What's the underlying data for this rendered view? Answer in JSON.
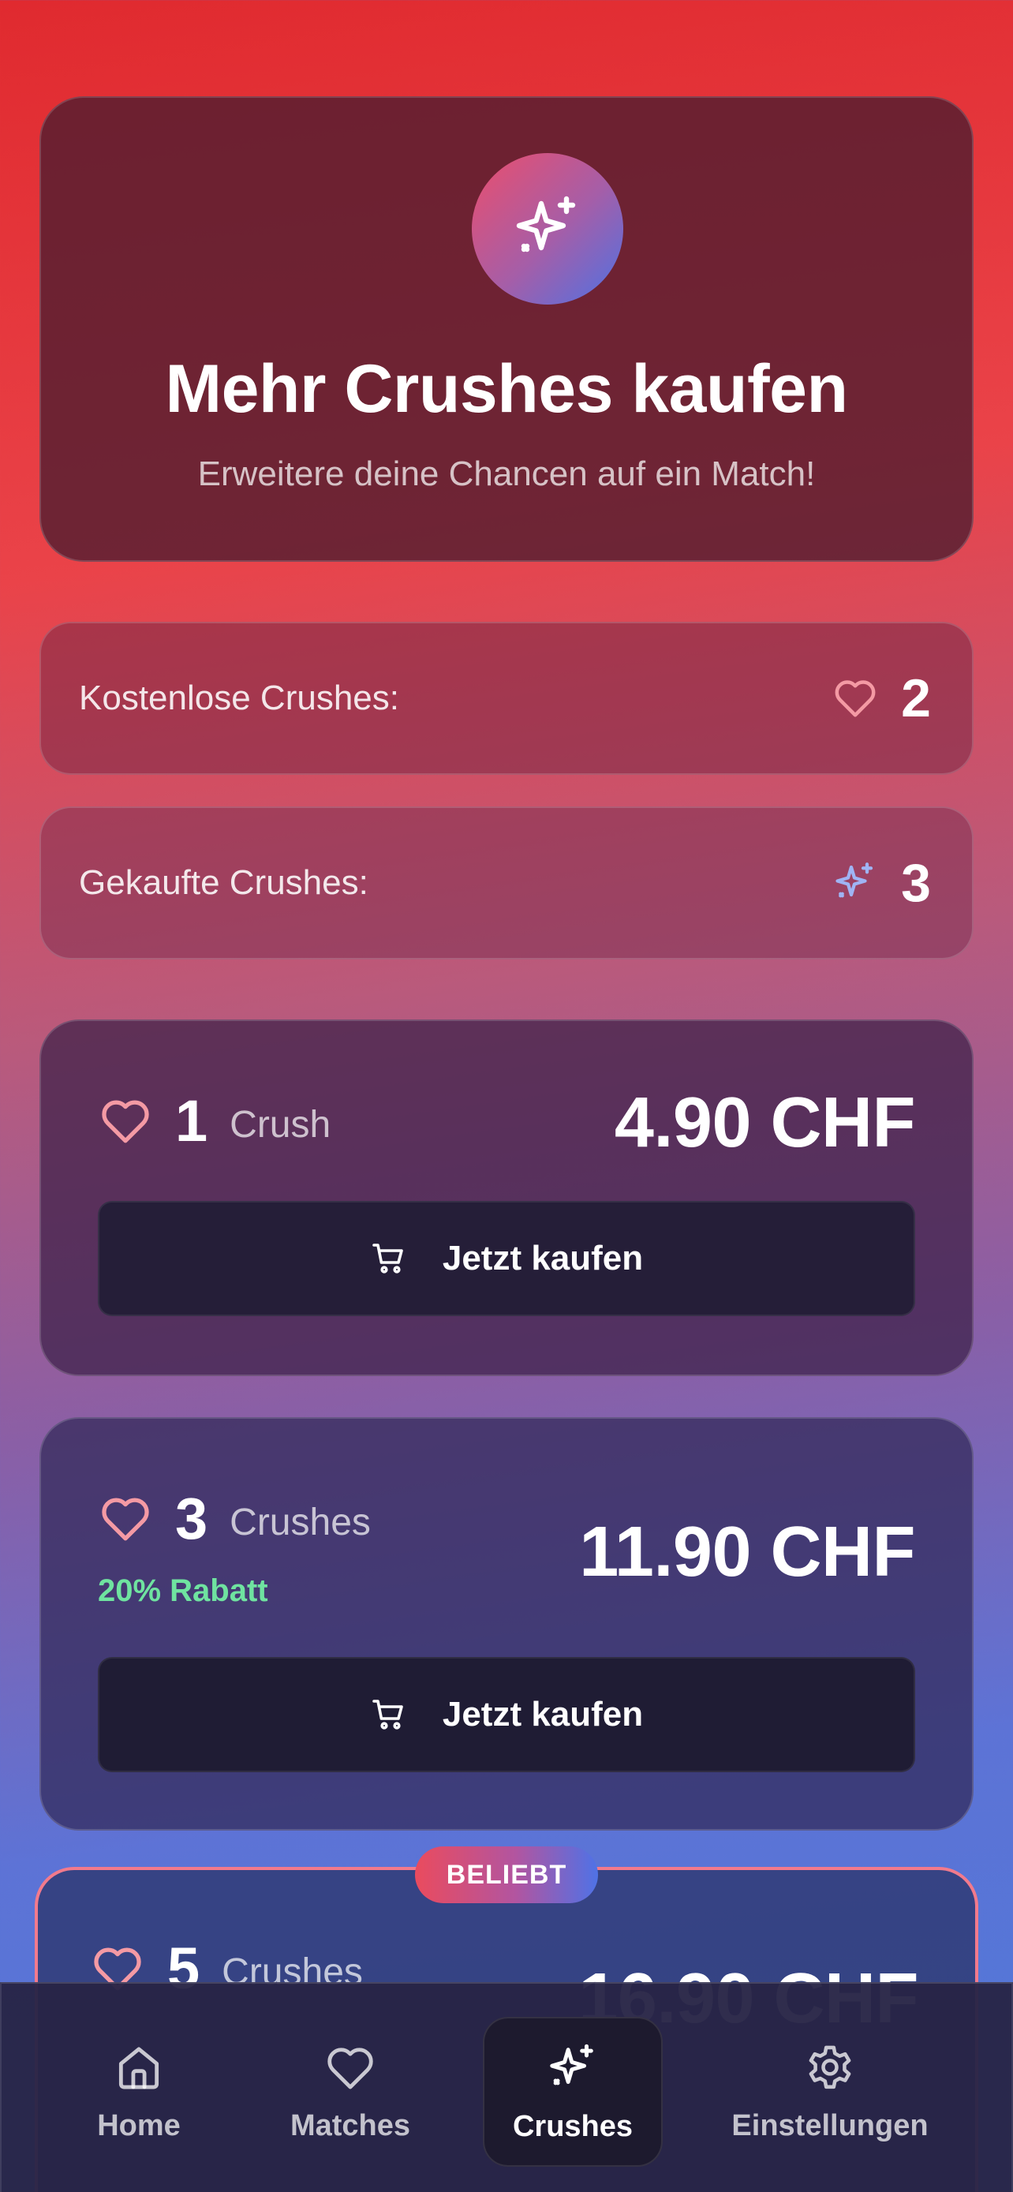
{
  "header": {
    "title": "Mehr Crushes kaufen",
    "subtitle": "Erweitere deine Chancen auf ein Match!",
    "icon": "sparkles-icon"
  },
  "balance": {
    "free": {
      "label": "Kostenlose Crushes:",
      "value": "2",
      "icon": "heart-icon"
    },
    "bought": {
      "label": "Gekaufte Crushes:",
      "value": "3",
      "icon": "sparkles-icon"
    }
  },
  "offers": [
    {
      "quantity": "1",
      "unit": "Crush",
      "price": "4.90 CHF",
      "discount": "",
      "button": "Jetzt kaufen"
    },
    {
      "quantity": "3",
      "unit": "Crushes",
      "price": "11.90 CHF",
      "discount": "20% Rabatt",
      "button": "Jetzt kaufen"
    },
    {
      "quantity": "5",
      "unit": "Crushes",
      "price": "16.90 CHF",
      "badge": "BELIEBT"
    }
  ],
  "nav": {
    "items": [
      {
        "label": "Home",
        "icon": "home-icon",
        "active": false
      },
      {
        "label": "Matches",
        "icon": "heart-icon",
        "active": false
      },
      {
        "label": "Crushes",
        "icon": "sparkles-icon",
        "active": true
      },
      {
        "label": "Einstellungen",
        "icon": "gear-icon",
        "active": false
      }
    ]
  },
  "colors": {
    "accent_pink": "#f49aa4",
    "accent_blue": "#9fb4f4",
    "discount_green": "#6fe3a0",
    "badge_border": "#f27a8c"
  }
}
